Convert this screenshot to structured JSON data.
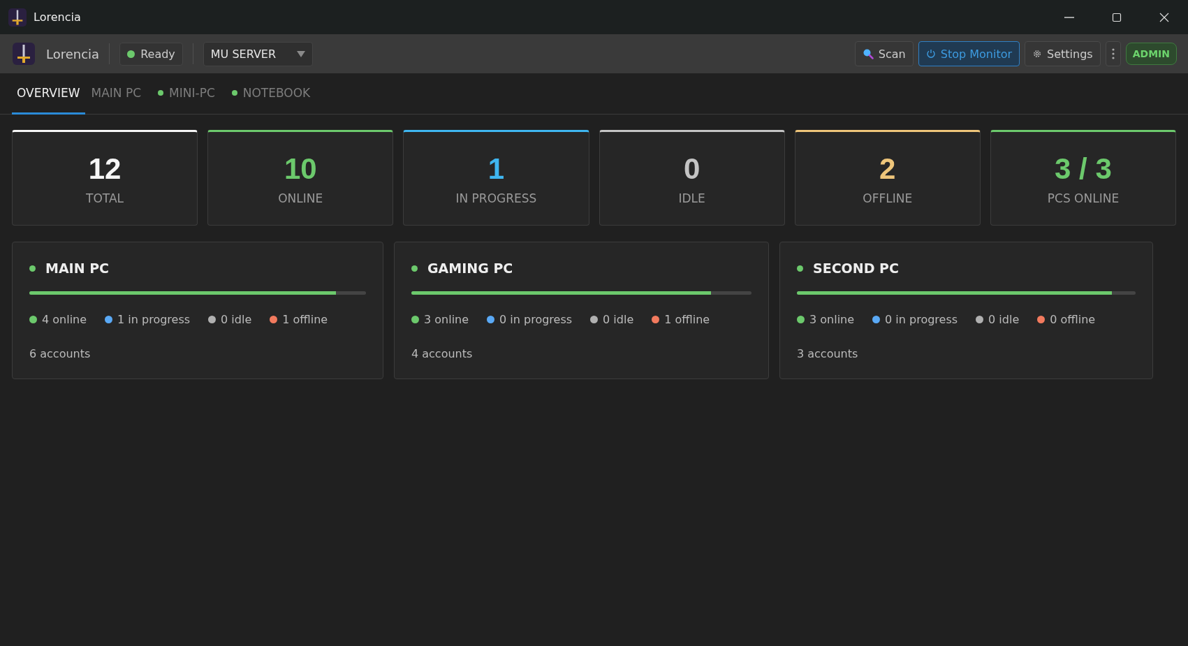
{
  "window": {
    "title": "Lorencia"
  },
  "toolbar": {
    "app_name": "Lorencia",
    "status": {
      "label": "Ready",
      "color": "#6cc96c"
    },
    "server": {
      "value": "MU SERVER"
    },
    "buttons": [
      {
        "kind": "scan",
        "label": "Scan"
      },
      {
        "kind": "stop",
        "label": "Stop Monitor"
      },
      {
        "kind": "settings",
        "label": "Settings"
      },
      {
        "kind": "more"
      }
    ],
    "role_badge": "ADMIN"
  },
  "tabs": [
    {
      "label": "OVERVIEW",
      "selected": true,
      "online": false
    },
    {
      "label": "MAIN PC",
      "selected": false,
      "online": false
    },
    {
      "label": "MINI-PC",
      "selected": false,
      "online": true
    },
    {
      "label": "NOTEBOOK",
      "selected": false,
      "online": true
    }
  ],
  "stats": [
    {
      "value": "12",
      "label": "TOTAL",
      "color": "#f5f5f5"
    },
    {
      "value": "10",
      "label": "ONLINE",
      "color": "#6cc96c"
    },
    {
      "value": "1",
      "label": "IN PROGRESS",
      "color": "#3fb6f0"
    },
    {
      "value": "0",
      "label": "IDLE",
      "color": "#c4c4c4"
    },
    {
      "value": "2",
      "label": "OFFLINE",
      "color": "#eec57a"
    },
    {
      "value": "3 / 3",
      "label": "PCS ONLINE",
      "color": "#6cc96c"
    }
  ],
  "pcs": [
    {
      "name": "MAIN PC",
      "online": true,
      "level": 0.91,
      "legend": [
        {
          "label": "4 online",
          "color": "#6cc96c"
        },
        {
          "label": "1 in progress",
          "color": "#5aa9f5"
        },
        {
          "label": "0 idle",
          "color": "#b0b0b0"
        },
        {
          "label": "1 offline",
          "color": "#f27a5e"
        }
      ],
      "accounts": "6 accounts"
    },
    {
      "name": "GAMING PC",
      "online": true,
      "level": 0.88,
      "legend": [
        {
          "label": "3 online",
          "color": "#6cc96c"
        },
        {
          "label": "0 in progress",
          "color": "#5aa9f5"
        },
        {
          "label": "0 idle",
          "color": "#b0b0b0"
        },
        {
          "label": "1 offline",
          "color": "#f27a5e"
        }
      ],
      "accounts": "4 accounts"
    },
    {
      "name": "SECOND PC",
      "online": true,
      "level": 0.93,
      "legend": [
        {
          "label": "3 online",
          "color": "#6cc96c"
        },
        {
          "label": "0 in progress",
          "color": "#5aa9f5"
        },
        {
          "label": "0 idle",
          "color": "#b0b0b0"
        },
        {
          "label": "0 offline",
          "color": "#f27a5e"
        }
      ],
      "accounts": "3 accounts"
    }
  ]
}
